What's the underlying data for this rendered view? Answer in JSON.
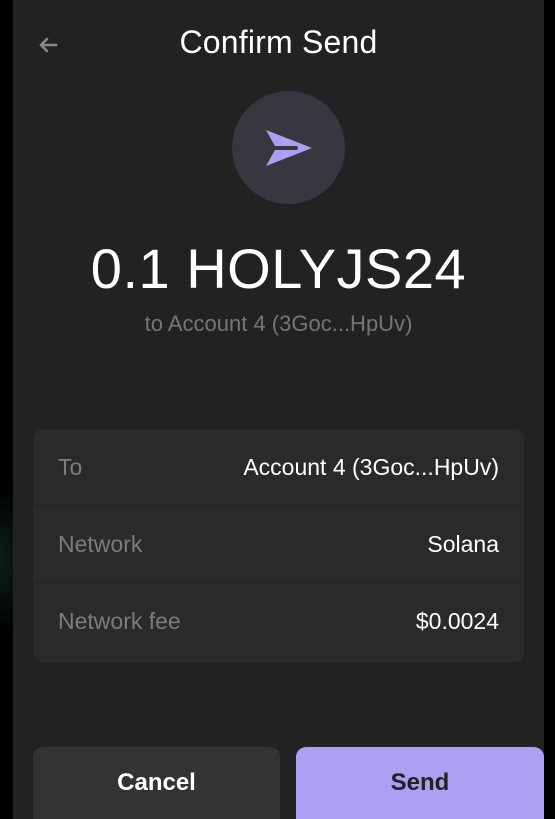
{
  "header": {
    "title": "Confirm Send",
    "back_icon": "arrow-left-icon"
  },
  "hero": {
    "icon": "paper-plane-icon",
    "accent": "#ab9ff2",
    "amount": "0.1 HOLYJS24",
    "subtitle": "to Account 4 (3Goc...HpUv)"
  },
  "details": [
    {
      "label": "To",
      "value": "Account 4 (3Goc...HpUv)"
    },
    {
      "label": "Network",
      "value": "Solana"
    },
    {
      "label": "Network fee",
      "value": "$0.0024"
    }
  ],
  "actions": {
    "cancel_label": "Cancel",
    "send_label": "Send"
  }
}
